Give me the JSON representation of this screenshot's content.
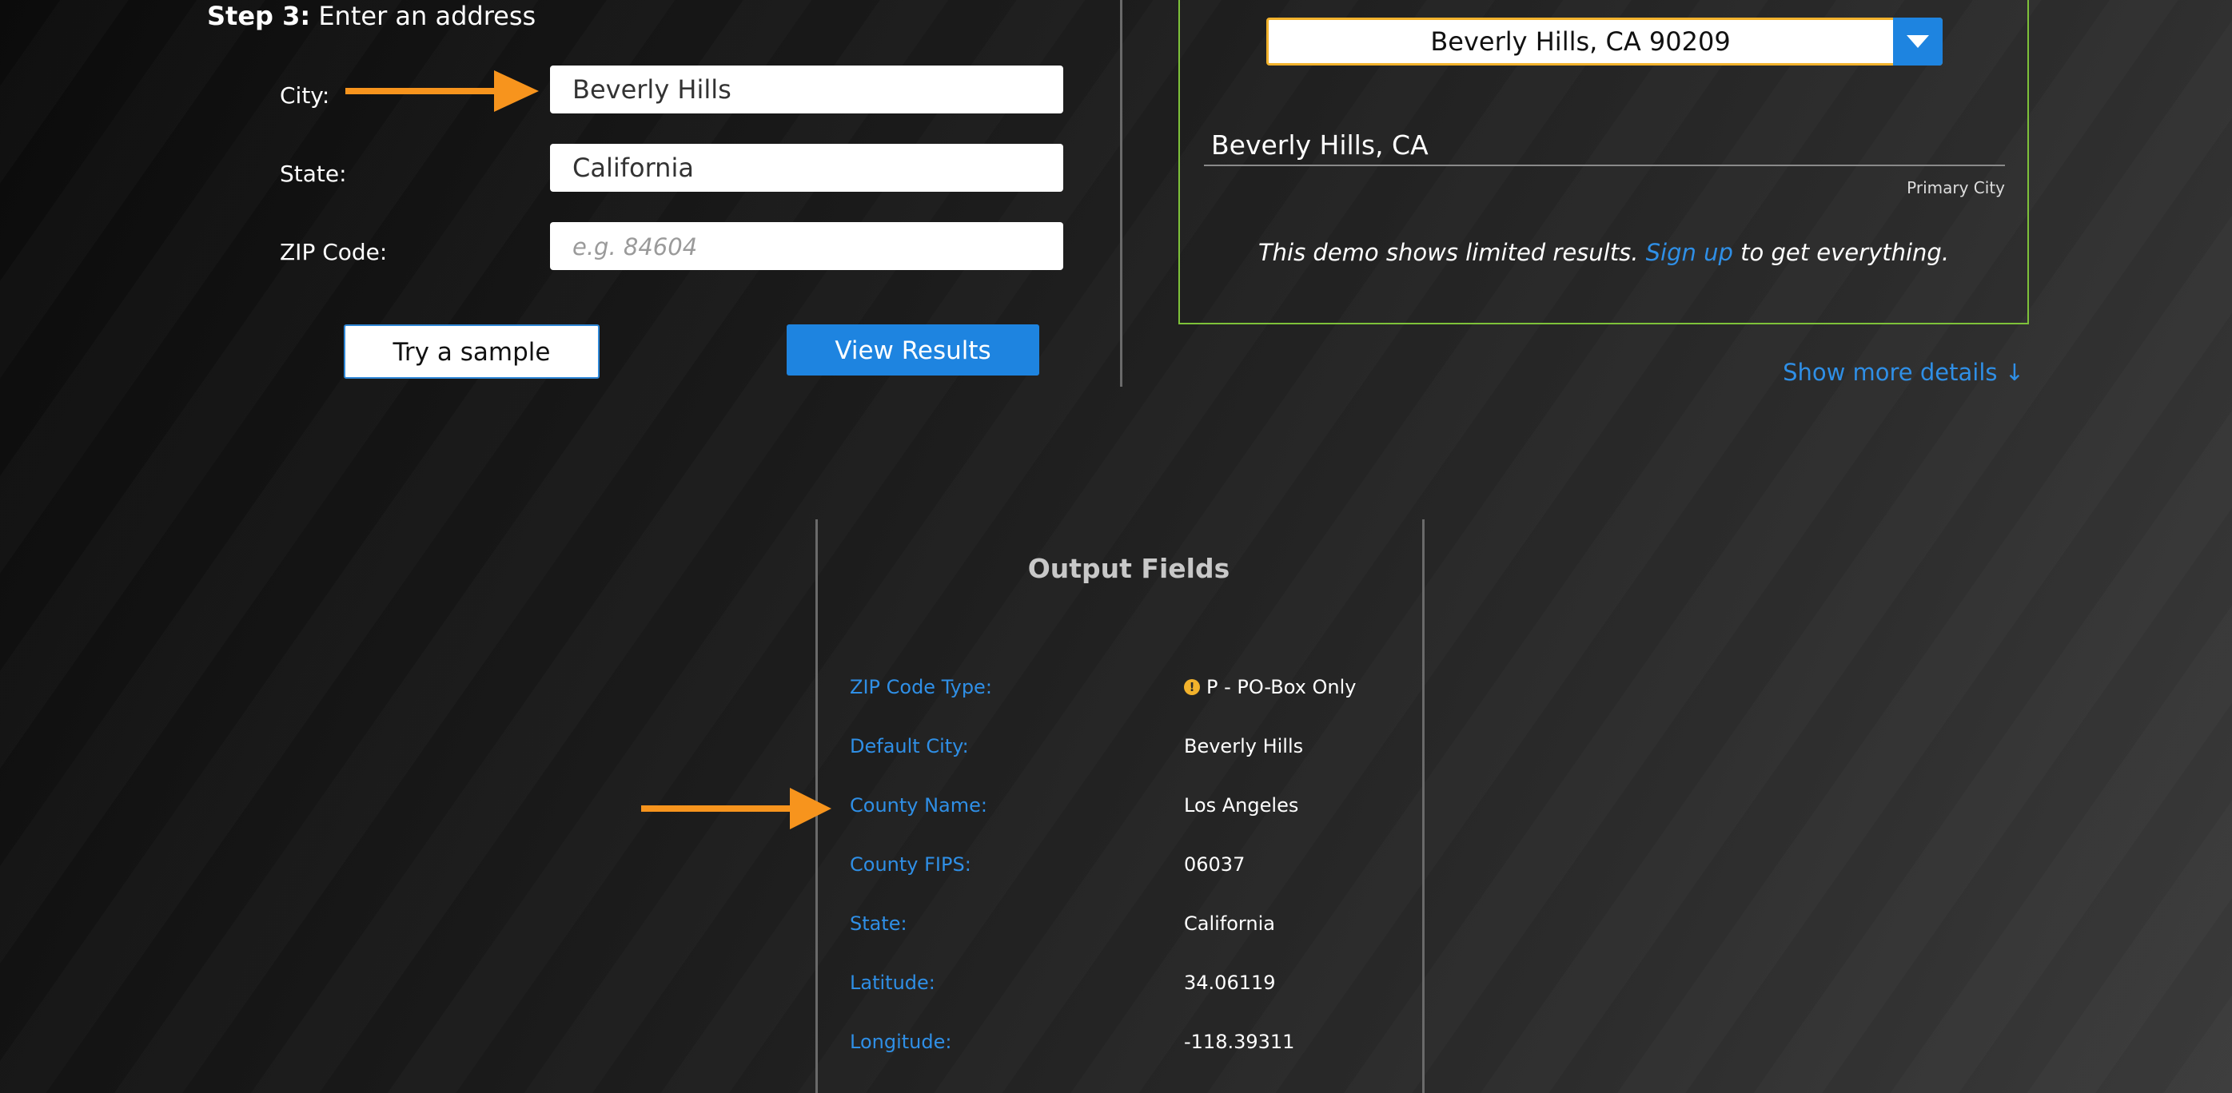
{
  "step": {
    "label": "Step 3:",
    "text": "Enter an address"
  },
  "form": {
    "city": {
      "label": "City:",
      "value": "Beverly Hills"
    },
    "state": {
      "label": "State:",
      "value": "California"
    },
    "zip": {
      "label": "ZIP Code:",
      "value": "",
      "placeholder": "e.g. 84604"
    },
    "sample_button": "Try a sample",
    "results_button": "View Results"
  },
  "result": {
    "select_value": "Beverly Hills, CA 90209",
    "title": "Beverly Hills, CA",
    "tag": "Primary City",
    "note_before": "This demo shows limited results.",
    "signup_link": "Sign up",
    "note_after": "to get everything.",
    "more_details": "Show more details ↓"
  },
  "output": {
    "title": "Output Fields",
    "fields": [
      {
        "label": "ZIP Code Type:",
        "value": "P - PO-Box Only",
        "icon": "warning-icon"
      },
      {
        "label": "Default City:",
        "value": "Beverly Hills"
      },
      {
        "label": "County Name:",
        "value": "Los Angeles"
      },
      {
        "label": "County FIPS:",
        "value": "06037"
      },
      {
        "label": "State:",
        "value": "California"
      },
      {
        "label": "Latitude:",
        "value": "34.06119"
      },
      {
        "label": "Longitude:",
        "value": "-118.39311"
      }
    ]
  },
  "colors": {
    "accent_blue": "#1e84e0",
    "link_blue": "#2f8fe6",
    "arrow_orange": "#f7941d",
    "panel_border_green": "#7ec23a",
    "select_border_yellow": "#f2b22c"
  }
}
